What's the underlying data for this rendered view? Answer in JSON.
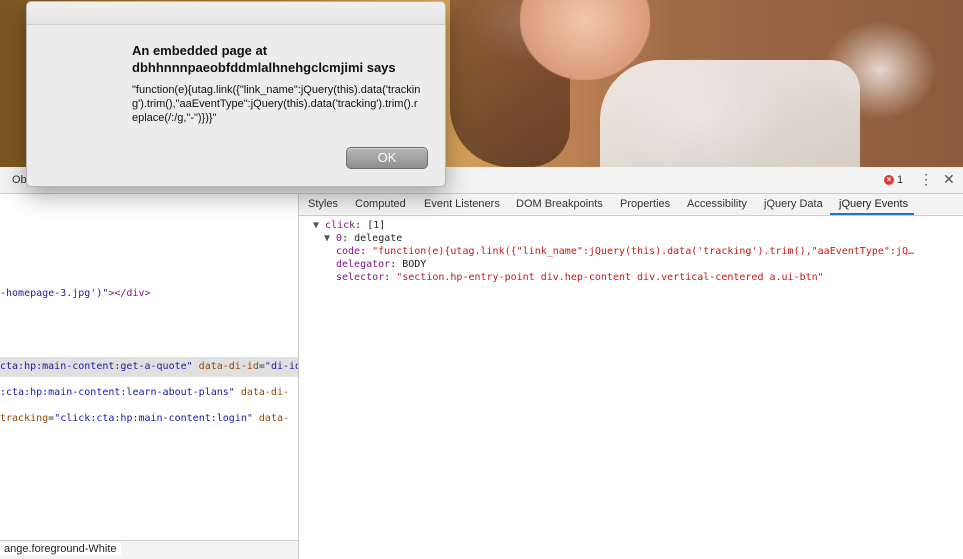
{
  "dialog": {
    "heading_line1": "An embedded page at",
    "heading_line2": "dbhhnnnpaeobfddmlalhnehgclcmjimi says",
    "message": "\"function(e){utag.link({\"link_name\":jQuery(this).data('tracking').trim(),\"aaEventType\":jQuery(this).data('tracking').trim().replace(/:/g,\"-\")})}\"",
    "ok_label": "OK"
  },
  "devtools": {
    "left_tab_partial": "Ob",
    "error_count": "1",
    "error_icon_glyph": "×",
    "menu_glyph": "⋮",
    "close_glyph": "✕",
    "tabs": [
      "Styles",
      "Computed",
      "Event Listeners",
      "DOM Breakpoints",
      "Properties",
      "Accessibility",
      "jQuery Data",
      "jQuery Events"
    ],
    "active_tab": "jQuery Events"
  },
  "elements": {
    "line1_a": "-homepage-3.jpg')\"",
    "line1_b": "></div>",
    "line2_a": "cta:hp:main-content:get-a-quote\"",
    "line2_b": " data-di-id",
    "line2_c": "=",
    "line2_d": "\"di-id-",
    "line3_a": ":cta:hp:main-content:learn-about-plans\"",
    "line3_b": " data-di-",
    "line4_a": "tracking",
    "line4_b": "=",
    "line4_c": "\"click:cta:hp:main-content:login\"",
    "line4_d": " data-",
    "breadcrumb": "ange.foreground-White"
  },
  "events": {
    "event_key": "click",
    "event_count": ": [1]",
    "item_key": "0",
    "item_value": ": delegate",
    "code_key": "code",
    "code_value": "\"function(e){utag.link({\"link_name\":jQuery(this).data('tracking').trim(),\"aaEventType\":jQ…",
    "delegator_key": "delegator",
    "delegator_value": "BODY",
    "selector_key": "selector",
    "selector_value": "\"section.hp-entry-point div.hep-content div.vertical-centered a.ui-btn\""
  },
  "colors": {
    "accent_tab": "#1a73e8",
    "error_red": "#e0393e",
    "string_red": "#c41a16",
    "key_purple": "#881280"
  }
}
